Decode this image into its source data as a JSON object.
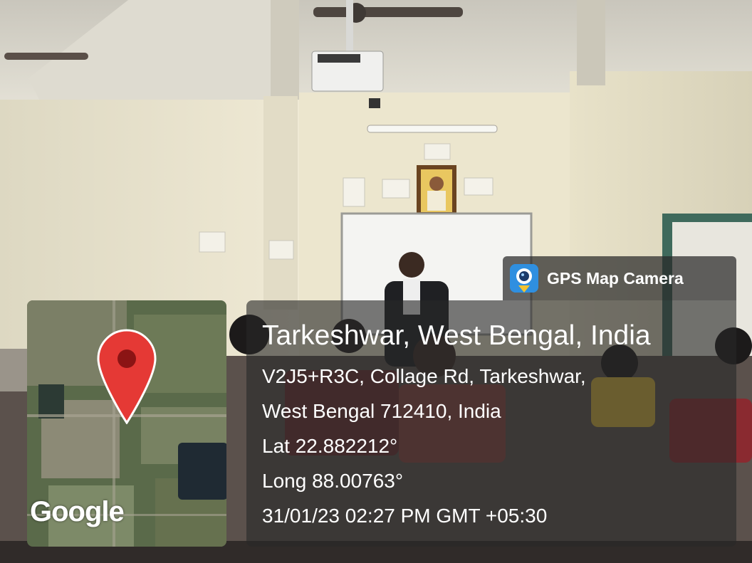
{
  "app": {
    "name": "GPS Map Camera",
    "icon": "camera-lens-pin-icon"
  },
  "map": {
    "logo": "Google",
    "marker_icon": "map-pin-icon",
    "marker_color": "#e53935"
  },
  "location": {
    "title": "Tarkeshwar, West Bengal, India",
    "address_line1": "V2J5+R3C, Collage Rd, Tarkeshwar,",
    "address_line2": "West Bengal 712410, India",
    "latitude": "Lat 22.882212°",
    "longitude": "Long 88.00763°",
    "datetime": "31/01/23 02:27 PM GMT +05:30"
  },
  "colors": {
    "overlay": "#282828",
    "text": "#ffffff",
    "app_icon": "#2f8fe0"
  }
}
